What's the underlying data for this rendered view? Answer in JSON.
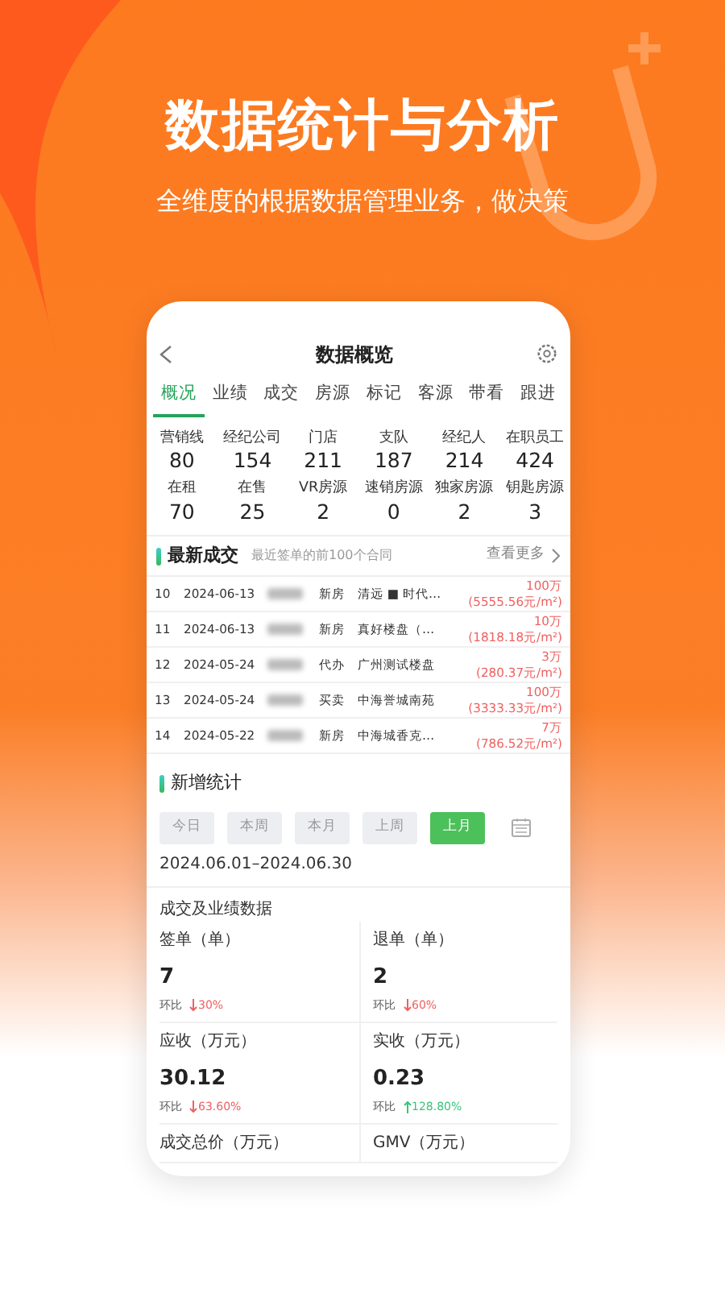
{
  "promo": {
    "title": "数据统计与分析",
    "subtitle": "全维度的根据数据管理业务，做决策"
  },
  "screen": {
    "title": "数据概览",
    "tabs": [
      {
        "label": "概况",
        "selected": true
      },
      {
        "label": "业绩",
        "selected": false
      },
      {
        "label": "成交",
        "selected": false
      },
      {
        "label": "房源",
        "selected": false
      },
      {
        "label": "标记",
        "selected": false
      },
      {
        "label": "客源",
        "selected": false
      },
      {
        "label": "带看",
        "selected": false
      },
      {
        "label": "跟进",
        "selected": false
      }
    ],
    "stats": [
      {
        "label": "营销线",
        "value": "80"
      },
      {
        "label": "经纪公司",
        "value": "154"
      },
      {
        "label": "门店",
        "value": "211"
      },
      {
        "label": "支队",
        "value": "187"
      },
      {
        "label": "经纪人",
        "value": "214"
      },
      {
        "label": "在职员工",
        "value": "424"
      },
      {
        "label": "在租",
        "value": "70"
      },
      {
        "label": "在售",
        "value": "25"
      },
      {
        "label": "VR房源",
        "value": "2"
      },
      {
        "label": "速销房源",
        "value": "0"
      },
      {
        "label": "独家房源",
        "value": "2"
      },
      {
        "label": "钥匙房源",
        "value": "3"
      }
    ],
    "latest": {
      "title": "最新成交",
      "subtitle": "最近签单的前100个合同",
      "more": "查看更多",
      "rows": [
        {
          "no": "10",
          "date": "2024-06-13",
          "type": "新房",
          "project": "清远 ■ 时代…",
          "amount": "100万",
          "unit_price": "(5555.56元/m²)"
        },
        {
          "no": "11",
          "date": "2024-06-13",
          "type": "新房",
          "project": "真好楼盘（…",
          "amount": "10万",
          "unit_price": "(1818.18元/m²)"
        },
        {
          "no": "12",
          "date": "2024-05-24",
          "type": "代办",
          "project": "广州测试楼盘",
          "amount": "3万",
          "unit_price": "(280.37元/m²)"
        },
        {
          "no": "13",
          "date": "2024-05-24",
          "type": "买卖",
          "project": "中海誉城南苑",
          "amount": "100万",
          "unit_price": "(3333.33元/m²)"
        },
        {
          "no": "14",
          "date": "2024-05-22",
          "type": "新房",
          "project": "中海城香克…",
          "amount": "7万",
          "unit_price": "(786.52元/m²)"
        }
      ]
    },
    "new_stats": {
      "title": "新增统计",
      "ranges": [
        {
          "label": "今日",
          "selected": false
        },
        {
          "label": "本周",
          "selected": false
        },
        {
          "label": "本月",
          "selected": false
        },
        {
          "label": "上周",
          "selected": false
        },
        {
          "label": "上月",
          "selected": true
        }
      ],
      "date_range": "2024.06.01–2024.06.30"
    },
    "performance": {
      "title": "成交及业绩数据",
      "metrics": [
        {
          "label": "签单（单）",
          "value": "7",
          "change_label": "环比",
          "change": "30%",
          "kind": "down"
        },
        {
          "label": "退单（单）",
          "value": "2",
          "change_label": "环比",
          "change": "60%",
          "kind": "down"
        },
        {
          "label": "应收（万元）",
          "value": "30.12",
          "change_label": "环比",
          "change": "63.60%",
          "kind": "down"
        },
        {
          "label": "实收（万元）",
          "value": "0.23",
          "change_label": "环比",
          "change": "128.80%",
          "kind": "up"
        },
        {
          "label": "成交总价（万元）"
        },
        {
          "label": "GMV（万元）"
        }
      ]
    }
  }
}
